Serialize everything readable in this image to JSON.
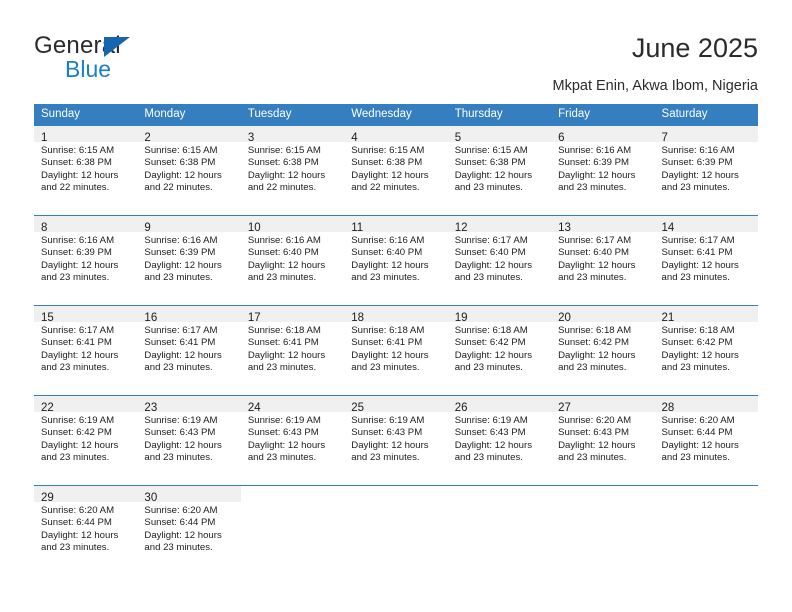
{
  "brand": {
    "name_top": "General",
    "name_bottom": "Blue",
    "triangle_color": "#1565b0",
    "blue_color": "#1a7ec8"
  },
  "header": {
    "title": "June 2025",
    "subtitle": "Mkpat Enin, Akwa Ibom, Nigeria"
  },
  "theme": {
    "header_bg": "#357ec0",
    "header_text": "#ffffff",
    "daynum_bg": "#f0f0f0",
    "row_rule": "#357ec0",
    "body_text": "#1d1d1d"
  },
  "columns": [
    "Sunday",
    "Monday",
    "Tuesday",
    "Wednesday",
    "Thursday",
    "Friday",
    "Saturday"
  ],
  "labels": {
    "sunrise_prefix": "Sunrise:",
    "sunset_prefix": "Sunset:",
    "daylight_prefix": "Daylight:"
  },
  "weeks": [
    [
      {
        "day": "1",
        "sunrise": "Sunrise: 6:15 AM",
        "sunset": "Sunset: 6:38 PM",
        "daylight_line1": "Daylight: 12 hours",
        "daylight_line2": "and 22 minutes."
      },
      {
        "day": "2",
        "sunrise": "Sunrise: 6:15 AM",
        "sunset": "Sunset: 6:38 PM",
        "daylight_line1": "Daylight: 12 hours",
        "daylight_line2": "and 22 minutes."
      },
      {
        "day": "3",
        "sunrise": "Sunrise: 6:15 AM",
        "sunset": "Sunset: 6:38 PM",
        "daylight_line1": "Daylight: 12 hours",
        "daylight_line2": "and 22 minutes."
      },
      {
        "day": "4",
        "sunrise": "Sunrise: 6:15 AM",
        "sunset": "Sunset: 6:38 PM",
        "daylight_line1": "Daylight: 12 hours",
        "daylight_line2": "and 22 minutes."
      },
      {
        "day": "5",
        "sunrise": "Sunrise: 6:15 AM",
        "sunset": "Sunset: 6:38 PM",
        "daylight_line1": "Daylight: 12 hours",
        "daylight_line2": "and 23 minutes."
      },
      {
        "day": "6",
        "sunrise": "Sunrise: 6:16 AM",
        "sunset": "Sunset: 6:39 PM",
        "daylight_line1": "Daylight: 12 hours",
        "daylight_line2": "and 23 minutes."
      },
      {
        "day": "7",
        "sunrise": "Sunrise: 6:16 AM",
        "sunset": "Sunset: 6:39 PM",
        "daylight_line1": "Daylight: 12 hours",
        "daylight_line2": "and 23 minutes."
      }
    ],
    [
      {
        "day": "8",
        "sunrise": "Sunrise: 6:16 AM",
        "sunset": "Sunset: 6:39 PM",
        "daylight_line1": "Daylight: 12 hours",
        "daylight_line2": "and 23 minutes."
      },
      {
        "day": "9",
        "sunrise": "Sunrise: 6:16 AM",
        "sunset": "Sunset: 6:39 PM",
        "daylight_line1": "Daylight: 12 hours",
        "daylight_line2": "and 23 minutes."
      },
      {
        "day": "10",
        "sunrise": "Sunrise: 6:16 AM",
        "sunset": "Sunset: 6:40 PM",
        "daylight_line1": "Daylight: 12 hours",
        "daylight_line2": "and 23 minutes."
      },
      {
        "day": "11",
        "sunrise": "Sunrise: 6:16 AM",
        "sunset": "Sunset: 6:40 PM",
        "daylight_line1": "Daylight: 12 hours",
        "daylight_line2": "and 23 minutes."
      },
      {
        "day": "12",
        "sunrise": "Sunrise: 6:17 AM",
        "sunset": "Sunset: 6:40 PM",
        "daylight_line1": "Daylight: 12 hours",
        "daylight_line2": "and 23 minutes."
      },
      {
        "day": "13",
        "sunrise": "Sunrise: 6:17 AM",
        "sunset": "Sunset: 6:40 PM",
        "daylight_line1": "Daylight: 12 hours",
        "daylight_line2": "and 23 minutes."
      },
      {
        "day": "14",
        "sunrise": "Sunrise: 6:17 AM",
        "sunset": "Sunset: 6:41 PM",
        "daylight_line1": "Daylight: 12 hours",
        "daylight_line2": "and 23 minutes."
      }
    ],
    [
      {
        "day": "15",
        "sunrise": "Sunrise: 6:17 AM",
        "sunset": "Sunset: 6:41 PM",
        "daylight_line1": "Daylight: 12 hours",
        "daylight_line2": "and 23 minutes."
      },
      {
        "day": "16",
        "sunrise": "Sunrise: 6:17 AM",
        "sunset": "Sunset: 6:41 PM",
        "daylight_line1": "Daylight: 12 hours",
        "daylight_line2": "and 23 minutes."
      },
      {
        "day": "17",
        "sunrise": "Sunrise: 6:18 AM",
        "sunset": "Sunset: 6:41 PM",
        "daylight_line1": "Daylight: 12 hours",
        "daylight_line2": "and 23 minutes."
      },
      {
        "day": "18",
        "sunrise": "Sunrise: 6:18 AM",
        "sunset": "Sunset: 6:41 PM",
        "daylight_line1": "Daylight: 12 hours",
        "daylight_line2": "and 23 minutes."
      },
      {
        "day": "19",
        "sunrise": "Sunrise: 6:18 AM",
        "sunset": "Sunset: 6:42 PM",
        "daylight_line1": "Daylight: 12 hours",
        "daylight_line2": "and 23 minutes."
      },
      {
        "day": "20",
        "sunrise": "Sunrise: 6:18 AM",
        "sunset": "Sunset: 6:42 PM",
        "daylight_line1": "Daylight: 12 hours",
        "daylight_line2": "and 23 minutes."
      },
      {
        "day": "21",
        "sunrise": "Sunrise: 6:18 AM",
        "sunset": "Sunset: 6:42 PM",
        "daylight_line1": "Daylight: 12 hours",
        "daylight_line2": "and 23 minutes."
      }
    ],
    [
      {
        "day": "22",
        "sunrise": "Sunrise: 6:19 AM",
        "sunset": "Sunset: 6:42 PM",
        "daylight_line1": "Daylight: 12 hours",
        "daylight_line2": "and 23 minutes."
      },
      {
        "day": "23",
        "sunrise": "Sunrise: 6:19 AM",
        "sunset": "Sunset: 6:43 PM",
        "daylight_line1": "Daylight: 12 hours",
        "daylight_line2": "and 23 minutes."
      },
      {
        "day": "24",
        "sunrise": "Sunrise: 6:19 AM",
        "sunset": "Sunset: 6:43 PM",
        "daylight_line1": "Daylight: 12 hours",
        "daylight_line2": "and 23 minutes."
      },
      {
        "day": "25",
        "sunrise": "Sunrise: 6:19 AM",
        "sunset": "Sunset: 6:43 PM",
        "daylight_line1": "Daylight: 12 hours",
        "daylight_line2": "and 23 minutes."
      },
      {
        "day": "26",
        "sunrise": "Sunrise: 6:19 AM",
        "sunset": "Sunset: 6:43 PM",
        "daylight_line1": "Daylight: 12 hours",
        "daylight_line2": "and 23 minutes."
      },
      {
        "day": "27",
        "sunrise": "Sunrise: 6:20 AM",
        "sunset": "Sunset: 6:43 PM",
        "daylight_line1": "Daylight: 12 hours",
        "daylight_line2": "and 23 minutes."
      },
      {
        "day": "28",
        "sunrise": "Sunrise: 6:20 AM",
        "sunset": "Sunset: 6:44 PM",
        "daylight_line1": "Daylight: 12 hours",
        "daylight_line2": "and 23 minutes."
      }
    ],
    [
      {
        "day": "29",
        "sunrise": "Sunrise: 6:20 AM",
        "sunset": "Sunset: 6:44 PM",
        "daylight_line1": "Daylight: 12 hours",
        "daylight_line2": "and 23 minutes."
      },
      {
        "day": "30",
        "sunrise": "Sunrise: 6:20 AM",
        "sunset": "Sunset: 6:44 PM",
        "daylight_line1": "Daylight: 12 hours",
        "daylight_line2": "and 23 minutes."
      },
      null,
      null,
      null,
      null,
      null
    ]
  ]
}
